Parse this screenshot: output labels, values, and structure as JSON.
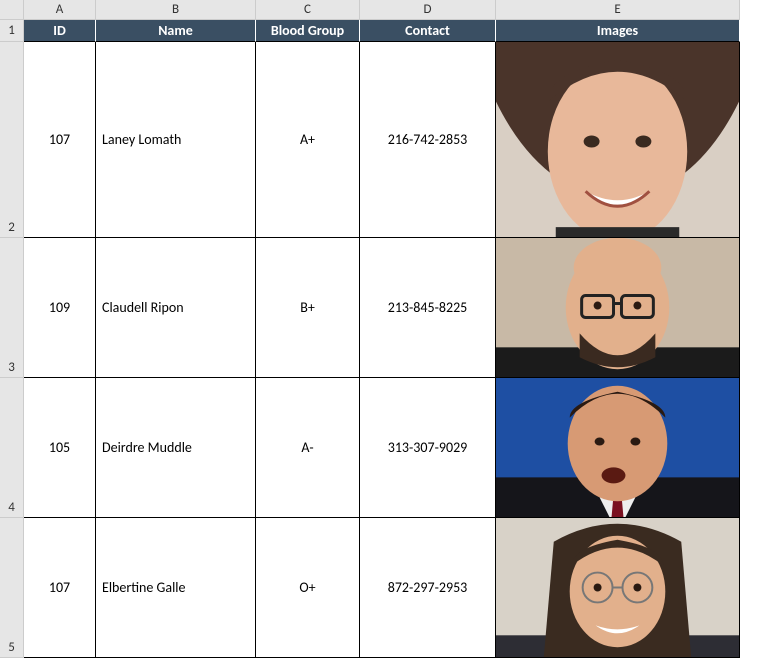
{
  "columns": {
    "A": "A",
    "B": "B",
    "C": "C",
    "D": "D",
    "E": "E"
  },
  "row_numbers": {
    "r1": "1",
    "r2": "2",
    "r3": "3",
    "r4": "4",
    "r5": "5"
  },
  "header": {
    "id": "ID",
    "name": "Name",
    "blood": "Blood Group",
    "contact": "Contact",
    "images": "Images"
  },
  "rows": [
    {
      "id": "107",
      "name": "Laney Lomath",
      "blood": "A+",
      "contact": "216-742-2853",
      "image": "avatar-woman-smiling"
    },
    {
      "id": "109",
      "name": "Claudell Ripon",
      "blood": "B+",
      "contact": "213-845-8225",
      "image": "avatar-bald-man-glasses"
    },
    {
      "id": "105",
      "name": "Deirdre Muddle",
      "blood": "A-",
      "contact": "313-307-9029",
      "image": "avatar-man-suit-speaking"
    },
    {
      "id": "107",
      "name": "Elbertine Galle",
      "blood": "O+",
      "contact": "872-297-2953",
      "image": "avatar-man-long-hair-glasses"
    }
  ]
}
